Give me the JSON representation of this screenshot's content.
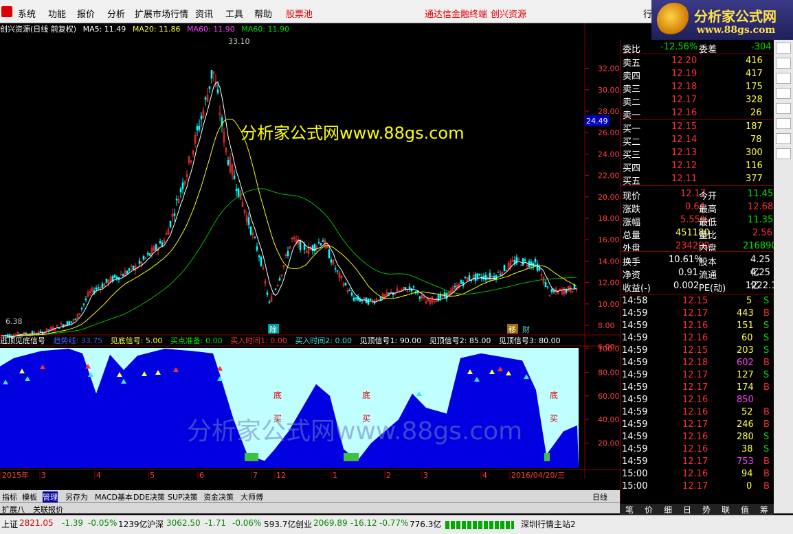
{
  "menu": {
    "items": [
      "系统",
      "功能",
      "报价",
      "分析",
      "扩展市场行情",
      "资讯",
      "工具",
      "帮助"
    ],
    "stock_pool": "股票池",
    "promo1": "通达信金融终端",
    "promo2": "创兴资源",
    "btn": "行"
  },
  "brand": {
    "line1": "分析家公式网",
    "line2": "www.88gs.com"
  },
  "chart": {
    "title": "创兴资源(日线 前复权)",
    "ma5": "MA5: 11.49",
    "ma20": "MA20: 11.86",
    "ma60a": "MA60: 11.90",
    "ma60b": "MA60: 11.90",
    "high_label": "33.10",
    "low_label": "6.38",
    "current_price": "24.49",
    "watermark1": "分析家公式网www.88gs.com",
    "watermark2": "分析家公式网www.88gs.com",
    "y_ticks": [
      "32.00",
      "30.00",
      "28.00",
      "26.00",
      "24.00",
      "22.00",
      "20.00",
      "18.00",
      "16.00",
      "14.00",
      "12.00",
      "10.00",
      "8.00",
      "6.00"
    ],
    "markers": [
      "除",
      "移",
      "财"
    ]
  },
  "indicator": {
    "name": "逃顶见底信号",
    "l1": "趋势线: 33.75",
    "l2": "见底信号: 5.00",
    "l3": "买点准备: 0.00",
    "l4": "买入时间1: 0.00",
    "l5": "买入时间2: 0.00",
    "l6": "见顶信号1: 90.00",
    "l7": "见顶信号2: 85.00",
    "l8": "见顶信号3: 80.00",
    "y_ticks": [
      "100.00",
      "80.00",
      "60.00",
      "40.00",
      "20.00"
    ],
    "labels": [
      "底",
      "买",
      "底",
      "买",
      "底",
      "买"
    ]
  },
  "xaxis": [
    "2015年",
    "3",
    "4",
    "5",
    "6",
    "7",
    "12",
    "1",
    "2",
    "3",
    "4",
    "2016/04/20/三"
  ],
  "period": "日线",
  "tabs": [
    "指标",
    "模板",
    "管理",
    "另存为",
    "MACD基本",
    "DDE决策",
    "SUP决策",
    "资金决策",
    "大师傅"
  ],
  "tabs2": [
    "扩展八",
    "关联报价"
  ],
  "quote": {
    "weibi_label": "委比",
    "weibi": "-12.56%",
    "weicha_label": "委差",
    "weicha": "-304",
    "asks": [
      {
        "l": "卖五",
        "p": "12.20",
        "v": "416"
      },
      {
        "l": "卖四",
        "p": "12.19",
        "v": "417"
      },
      {
        "l": "卖三",
        "p": "12.18",
        "v": "175"
      },
      {
        "l": "卖二",
        "p": "12.17",
        "v": "328"
      },
      {
        "l": "卖一",
        "p": "12.16",
        "v": "26"
      }
    ],
    "bids": [
      {
        "l": "买一",
        "p": "12.15",
        "v": "187"
      },
      {
        "l": "买二",
        "p": "12.14",
        "v": "78"
      },
      {
        "l": "买三",
        "p": "12.13",
        "v": "300"
      },
      {
        "l": "买四",
        "p": "12.12",
        "v": "116"
      },
      {
        "l": "买五",
        "p": "12.11",
        "v": "377"
      }
    ],
    "stats": [
      {
        "a": "现价",
        "b": "12.17",
        "c": "今开",
        "d": "11.45"
      },
      {
        "a": "涨跌",
        "b": "0.64",
        "c": "最高",
        "d": "12.68"
      },
      {
        "a": "涨幅",
        "b": "5.55%",
        "c": "最低",
        "d": "11.35"
      },
      {
        "a": "总量",
        "b": "451180",
        "c": "量比",
        "d": "2.56"
      },
      {
        "a": "外盘",
        "b": "234290",
        "c": "内盘",
        "d": "216890"
      }
    ],
    "stats2": [
      {
        "a": "换手",
        "b": "10.61%",
        "c": "股本",
        "d": "4.25亿"
      },
      {
        "a": "净资",
        "b": "0.91",
        "c": "流通",
        "d": "4.25亿"
      },
      {
        "a": "收益(-)",
        "b": "0.002",
        "c": "PE(动)",
        "d": "1222.1"
      }
    ],
    "ticks": [
      [
        "14:58",
        "12.15",
        "5",
        "S"
      ],
      [
        "14:59",
        "12.17",
        "443",
        "B"
      ],
      [
        "14:59",
        "12.16",
        "151",
        "S"
      ],
      [
        "14:59",
        "12.16",
        "60",
        "S"
      ],
      [
        "14:59",
        "12.15",
        "203",
        "S"
      ],
      [
        "14:59",
        "12.18",
        "602",
        "B"
      ],
      [
        "14:59",
        "12.17",
        "127",
        "S"
      ],
      [
        "14:59",
        "12.17",
        "174",
        "B"
      ],
      [
        "14:59",
        "12.16",
        "850",
        ""
      ],
      [
        "14:59",
        "12.16",
        "52",
        "B"
      ],
      [
        "14:59",
        "12.17",
        "246",
        "B"
      ],
      [
        "14:59",
        "12.16",
        "280",
        "S"
      ],
      [
        "14:59",
        "12.16",
        "38",
        "S"
      ],
      [
        "14:59",
        "12.17",
        "753",
        "B"
      ],
      [
        "15:00",
        "12.16",
        "94",
        "B"
      ],
      [
        "15:00",
        "12.17",
        "0",
        "B"
      ]
    ]
  },
  "rtabs": [
    "笔",
    "价",
    "细",
    "日",
    "势",
    "联",
    "值",
    "筹"
  ],
  "status": {
    "sh": "上证",
    "sh_v": "2821.05",
    "sh_c": "-1.39",
    "sh_p": "-0.05%",
    "sh_a": "1239亿",
    "sz": "沪深",
    "sz_v": "3062.50",
    "sz_c": "-1.71",
    "sz_p": "-0.06%",
    "sz_a": "593.7亿",
    "cy": "创业",
    "cy_v": "2069.89",
    "cy_c": "-16.12",
    "cy_p": "-0.77%",
    "cy_a": "776.3亿",
    "server": "深圳行情主站2"
  },
  "colors": {
    "up": "#ff3030",
    "down": "#00ffff",
    "ma5": "#ffffff",
    "ma20": "#ffff00",
    "ma60": "#00c000",
    "fill_blue": "#0000e0",
    "fill_light": "#c0ffff"
  }
}
